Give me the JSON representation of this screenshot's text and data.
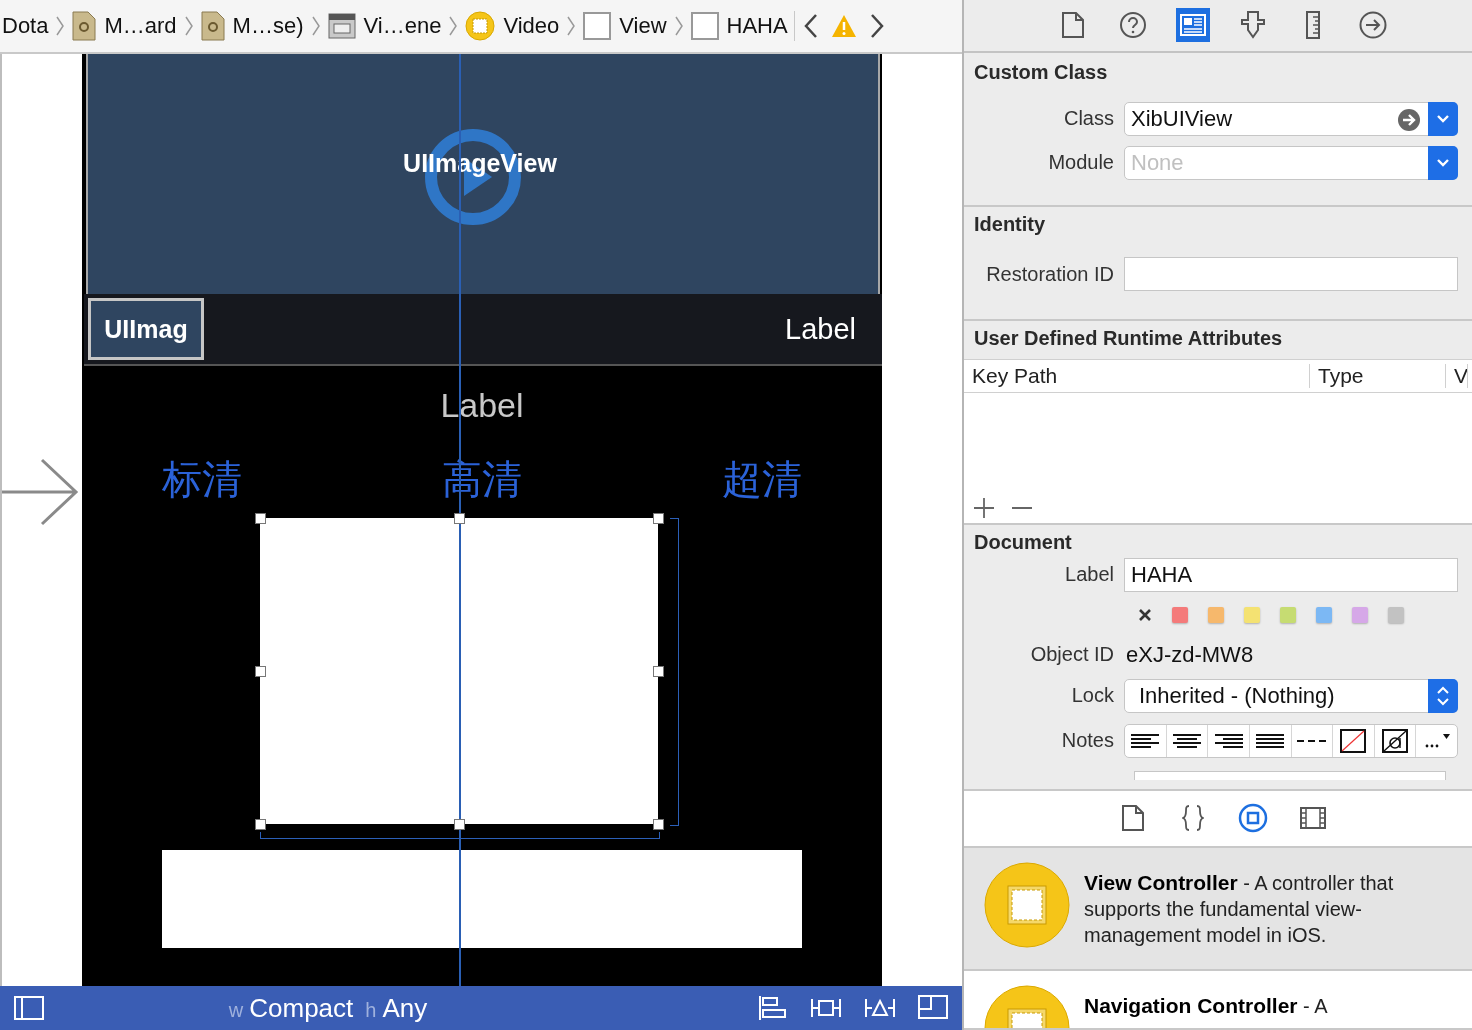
{
  "breadcrumbs": [
    {
      "label": "Dota",
      "kind": "folder"
    },
    {
      "label": "M…ard",
      "kind": "storyboard"
    },
    {
      "label": "M…se)",
      "kind": "storyboard"
    },
    {
      "label": "Vi…ene",
      "kind": "scene"
    },
    {
      "label": "Video",
      "kind": "controller"
    },
    {
      "label": "View",
      "kind": "view"
    },
    {
      "label": "HAHA",
      "kind": "view"
    }
  ],
  "canvas": {
    "image_view": {
      "title": "UIImageView"
    },
    "overlay_bar": {
      "thumbnail_label": "UIImag",
      "label": "Label"
    },
    "center_label": "Label",
    "quality_options": [
      {
        "label": "标清"
      },
      {
        "label": "高清"
      },
      {
        "label": "超清"
      }
    ]
  },
  "size_class_bar": {
    "width_prefix": "w",
    "width": "Compact",
    "height_prefix": "h",
    "height": "Any"
  },
  "inspector": {
    "tabs": [
      {
        "kind": "file",
        "selected": false
      },
      {
        "kind": "help",
        "selected": false
      },
      {
        "kind": "identity",
        "selected": true
      },
      {
        "kind": "attributes",
        "selected": false
      },
      {
        "kind": "size",
        "selected": false
      },
      {
        "kind": "connections",
        "selected": false
      }
    ],
    "custom_class": {
      "title": "Custom Class",
      "class_label": "Class",
      "class_value": "XibUIView",
      "module_label": "Module",
      "module_placeholder": "None"
    },
    "identity": {
      "title": "Identity",
      "restoration_id_label": "Restoration ID"
    },
    "runtime_attributes": {
      "title": "User Defined Runtime Attributes",
      "columns": [
        "Key Path",
        "Type",
        "V"
      ]
    },
    "document": {
      "title": "Document",
      "label_label": "Label",
      "label_value": "HAHA",
      "colors": [
        {
          "color": "#f47a7a"
        },
        {
          "color": "#f6b86c"
        },
        {
          "color": "#f4e272"
        },
        {
          "color": "#c6dc72"
        },
        {
          "color": "#7cb8f4"
        },
        {
          "color": "#d6a8e8"
        },
        {
          "color": "#c2c2c2"
        }
      ],
      "object_id_label": "Object ID",
      "object_id": "eXJ-zd-MW8",
      "lock_label": "Lock",
      "lock_value": "Inherited - (Nothing)",
      "notes_label": "Notes"
    }
  },
  "library": {
    "tabs": [
      {
        "kind": "file",
        "selected": false
      },
      {
        "kind": "code",
        "selected": false
      },
      {
        "kind": "object",
        "selected": true
      },
      {
        "kind": "media",
        "selected": false
      }
    ],
    "items": [
      {
        "description": "**View Controller** - A controller that supports the fundamental view-management model in iOS."
      },
      {
        "description": "**Navigation Controller** - A"
      }
    ]
  }
}
